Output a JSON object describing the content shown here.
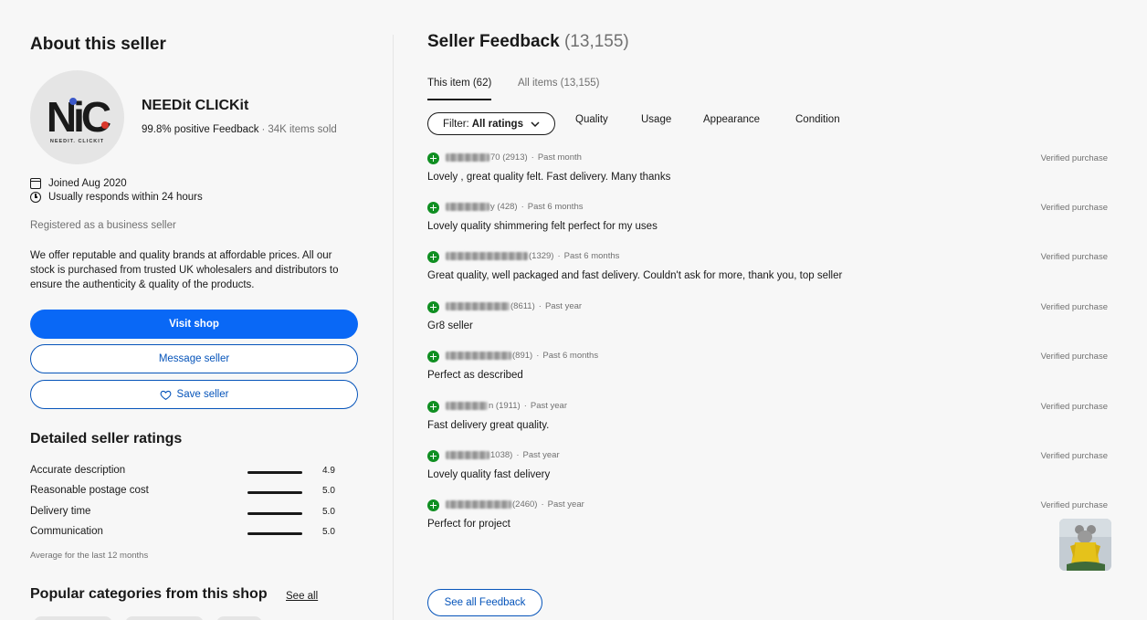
{
  "about": {
    "heading": "About this seller",
    "logo_monogram": "NiC",
    "logo_sub": "NEEDIT. CLICKIT",
    "seller_name": "NEEDit CLICKit",
    "positive_feedback": "99.8% positive Feedback",
    "separator": "·",
    "items_sold": "34K items sold",
    "joined": "Joined Aug 2020",
    "responds": "Usually responds within 24 hours",
    "registered": "Registered as a business seller",
    "description": "We offer reputable and quality brands at affordable prices. All our stock is purchased from trusted UK wholesalers and distributors to ensure the authenticity & quality of the products.",
    "visit_shop": "Visit shop",
    "message_seller": "Message seller",
    "save_seller": "Save seller"
  },
  "detailed": {
    "heading": "Detailed seller ratings",
    "ratings": [
      {
        "label": "Accurate description",
        "value": "4.9"
      },
      {
        "label": "Reasonable postage cost",
        "value": "5.0"
      },
      {
        "label": "Delivery time",
        "value": "5.0"
      },
      {
        "label": "Communication",
        "value": "5.0"
      }
    ],
    "note": "Average for the last 12 months"
  },
  "popular": {
    "heading": "Popular categories from this shop",
    "see_all": "See all"
  },
  "feedback": {
    "heading": "Seller Feedback",
    "total": "(13,155)",
    "tabs": [
      "This item (62)",
      "All items (13,155)"
    ],
    "filter_label": "Filter:",
    "filter_value": "All ratings",
    "filter_tabs": [
      "Quality",
      "Usage",
      "Appearance",
      "Condition"
    ],
    "verified_label": "Verified purchase",
    "items": [
      {
        "user_suffix": "70 (2913)",
        "when": "Past month",
        "text": "Lovely , great quality felt. Fast delivery. Many thanks"
      },
      {
        "user_suffix": "y (428)",
        "when": "Past 6 months",
        "text": "Lovely quality shimmering felt perfect for my uses"
      },
      {
        "user_suffix": "(1329)",
        "when": "Past 6 months",
        "text": "Great quality, well packaged and fast delivery. Couldn't ask for more, thank you, top seller"
      },
      {
        "user_suffix": "(8611)",
        "when": "Past year",
        "text": "Gr8 seller"
      },
      {
        "user_suffix": "(891)",
        "when": "Past 6 months",
        "text": "Perfect as described"
      },
      {
        "user_suffix": "n (1911)",
        "when": "Past year",
        "text": "Fast delivery great quality."
      },
      {
        "user_suffix": "1038)",
        "when": "Past year",
        "text": "Lovely quality fast delivery"
      },
      {
        "user_suffix": "(2460)",
        "when": "Past year",
        "text": "Perfect for project"
      }
    ],
    "see_all_button": "See all Feedback"
  },
  "colors": {
    "primary_blue": "#0968f6",
    "link_blue": "#0654ba",
    "positive_green": "#108f22",
    "background": "#f7f7f7"
  }
}
